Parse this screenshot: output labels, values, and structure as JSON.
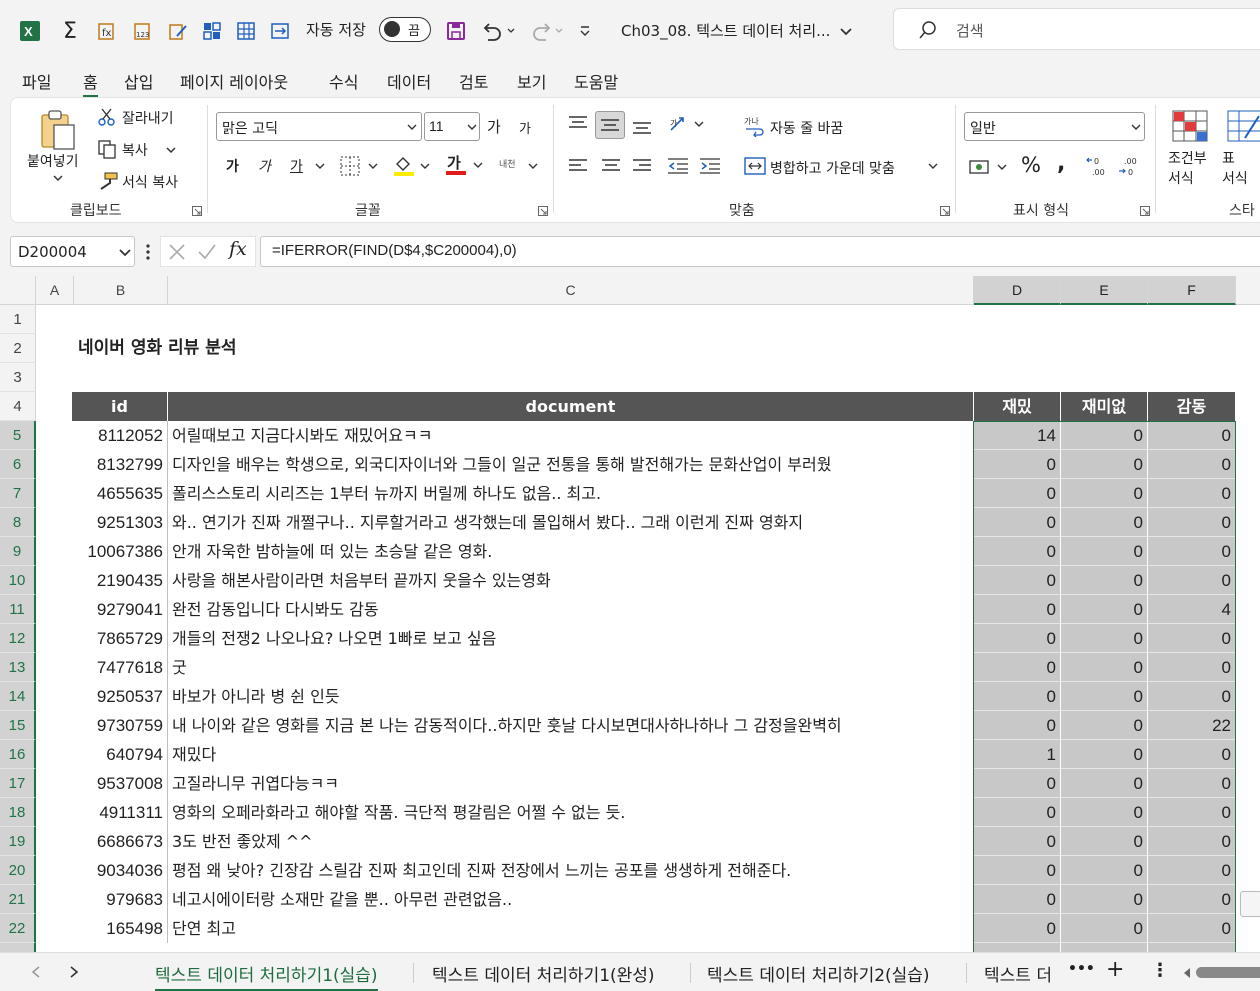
{
  "titlebar": {
    "autosave_label": "자동 저장",
    "autosave_state": "끔",
    "doc_title": "Ch03_08. 텍스트 데이터 처리...",
    "search_placeholder": "검색"
  },
  "menu": [
    "파일",
    "홈",
    "삽입",
    "페이지 레이아웃",
    "수식",
    "데이터",
    "검토",
    "보기",
    "도움말"
  ],
  "ribbon": {
    "clipboard": {
      "paste": "붙여넣기",
      "cut": "잘라내기",
      "copy": "복사",
      "format_painter": "서식 복사",
      "label": "클립보드"
    },
    "font": {
      "name": "맑은 고딕",
      "size": "11",
      "grow": "가",
      "shrink": "가",
      "bold": "가",
      "italic": "가",
      "underline": "가",
      "phonetic": "내천",
      "label": "글꼴"
    },
    "alignment": {
      "wrap": "자동 줄 바꿈",
      "merge": "병합하고 가운데 맞춤",
      "label": "맞춤"
    },
    "number": {
      "format": "일반",
      "percent": "%",
      "comma": ",",
      "label": "표시 형식"
    },
    "styles": {
      "conditional": "조건부\n서식",
      "table": "표\n서식",
      "label": "스타"
    }
  },
  "formula_bar": {
    "name_box": "D200004",
    "fx": "fx",
    "formula": "=IFERROR(FIND(D$4,$C200004),0)"
  },
  "columns": [
    "A",
    "B",
    "C",
    "D",
    "E",
    "F"
  ],
  "sheet": {
    "title": "네이버 영화 리뷰 분석",
    "headers": {
      "id": "id",
      "document": "document",
      "d": "재밌",
      "e": "재미없",
      "f": "감동"
    },
    "rows": [
      {
        "r": "5",
        "id": "8112052",
        "doc": "어릴때보고 지금다시봐도 재밌어요ㅋㅋ",
        "d": "14",
        "e": "0",
        "f": "0"
      },
      {
        "r": "6",
        "id": "8132799",
        "doc": "디자인을 배우는 학생으로, 외국디자이너와 그들이 일군 전통을 통해 발전해가는 문화산업이 부러웠",
        "d": "0",
        "e": "0",
        "f": "0"
      },
      {
        "r": "7",
        "id": "4655635",
        "doc": "폴리스스토리 시리즈는 1부터 뉴까지 버릴께 하나도 없음.. 최고.",
        "d": "0",
        "e": "0",
        "f": "0"
      },
      {
        "r": "8",
        "id": "9251303",
        "doc": "와.. 연기가 진짜 개쩔구나.. 지루할거라고 생각했는데 몰입해서 봤다.. 그래 이런게 진짜 영화지",
        "d": "0",
        "e": "0",
        "f": "0"
      },
      {
        "r": "9",
        "id": "10067386",
        "doc": "안개 자욱한 밤하늘에 떠 있는 초승달 같은 영화.",
        "d": "0",
        "e": "0",
        "f": "0"
      },
      {
        "r": "10",
        "id": "2190435",
        "doc": "사랑을 해본사람이라면 처음부터 끝까지 웃을수 있는영화",
        "d": "0",
        "e": "0",
        "f": "0"
      },
      {
        "r": "11",
        "id": "9279041",
        "doc": "완전 감동입니다 다시봐도 감동",
        "d": "0",
        "e": "0",
        "f": "4"
      },
      {
        "r": "12",
        "id": "7865729",
        "doc": "개들의 전쟁2 나오나요? 나오면 1빠로 보고 싶음",
        "d": "0",
        "e": "0",
        "f": "0"
      },
      {
        "r": "13",
        "id": "7477618",
        "doc": "굿",
        "d": "0",
        "e": "0",
        "f": "0"
      },
      {
        "r": "14",
        "id": "9250537",
        "doc": "바보가 아니라 병 쉰 인듯",
        "d": "0",
        "e": "0",
        "f": "0"
      },
      {
        "r": "15",
        "id": "9730759",
        "doc": "내 나이와 같은 영화를 지금 본 나는 감동적이다..하지만 훗날 다시보면대사하나하나 그 감정을완벽히",
        "d": "0",
        "e": "0",
        "f": "22"
      },
      {
        "r": "16",
        "id": "640794",
        "doc": "재밌다",
        "d": "1",
        "e": "0",
        "f": "0"
      },
      {
        "r": "17",
        "id": "9537008",
        "doc": "고질라니무 귀엽다능ㅋㅋ",
        "d": "0",
        "e": "0",
        "f": "0"
      },
      {
        "r": "18",
        "id": "4911311",
        "doc": "영화의 오페라화라고 해야할 작품. 극단적 평갈림은 어쩔 수 없는 듯.",
        "d": "0",
        "e": "0",
        "f": "0"
      },
      {
        "r": "19",
        "id": "6686673",
        "doc": "3도 반전 좋았제 ^^",
        "d": "0",
        "e": "0",
        "f": "0"
      },
      {
        "r": "20",
        "id": "9034036",
        "doc": "평점 왜 낮아? 긴장감 스릴감 진짜 최고인데 진짜 전장에서 느끼는 공포를 생생하게 전해준다.",
        "d": "0",
        "e": "0",
        "f": "0"
      },
      {
        "r": "21",
        "id": "979683",
        "doc": "네고시에이터랑 소재만 같을 뿐.. 아무런 관련없음..",
        "d": "0",
        "e": "0",
        "f": "0"
      },
      {
        "r": "22",
        "id": "165498",
        "doc": "단연 최고",
        "d": "0",
        "e": "0",
        "f": "0"
      }
    ]
  },
  "tabs": [
    "텍스트 데이터 처리하기1(실습)",
    "텍스트 데이터 처리하기1(완성)",
    "텍스트 데이터 처리하기2(실습)",
    "텍스트 더"
  ],
  "tab_more": "•••",
  "tab_add": "+",
  "tab_options": "⋮",
  "colors": {
    "excel_green": "#217346",
    "header_fill": "#555555",
    "selection_fill": "#c8c8c8"
  }
}
